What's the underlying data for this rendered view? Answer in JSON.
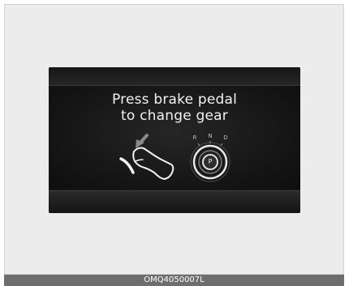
{
  "display": {
    "message_line1": "Press brake pedal",
    "message_line2": "to change gear",
    "gear_indicator": {
      "labels": [
        "R",
        "N",
        "D"
      ],
      "current": "P"
    },
    "icons": [
      "brake-pedal-icon",
      "foot-icon",
      "down-arrow-icon",
      "gear-knob-icon"
    ]
  },
  "figure_code": "OMQ4050007L",
  "colors": {
    "panel_background": "#1c1c1c",
    "text": "#f2f2f2",
    "footer_background": "#6d6d6d"
  }
}
